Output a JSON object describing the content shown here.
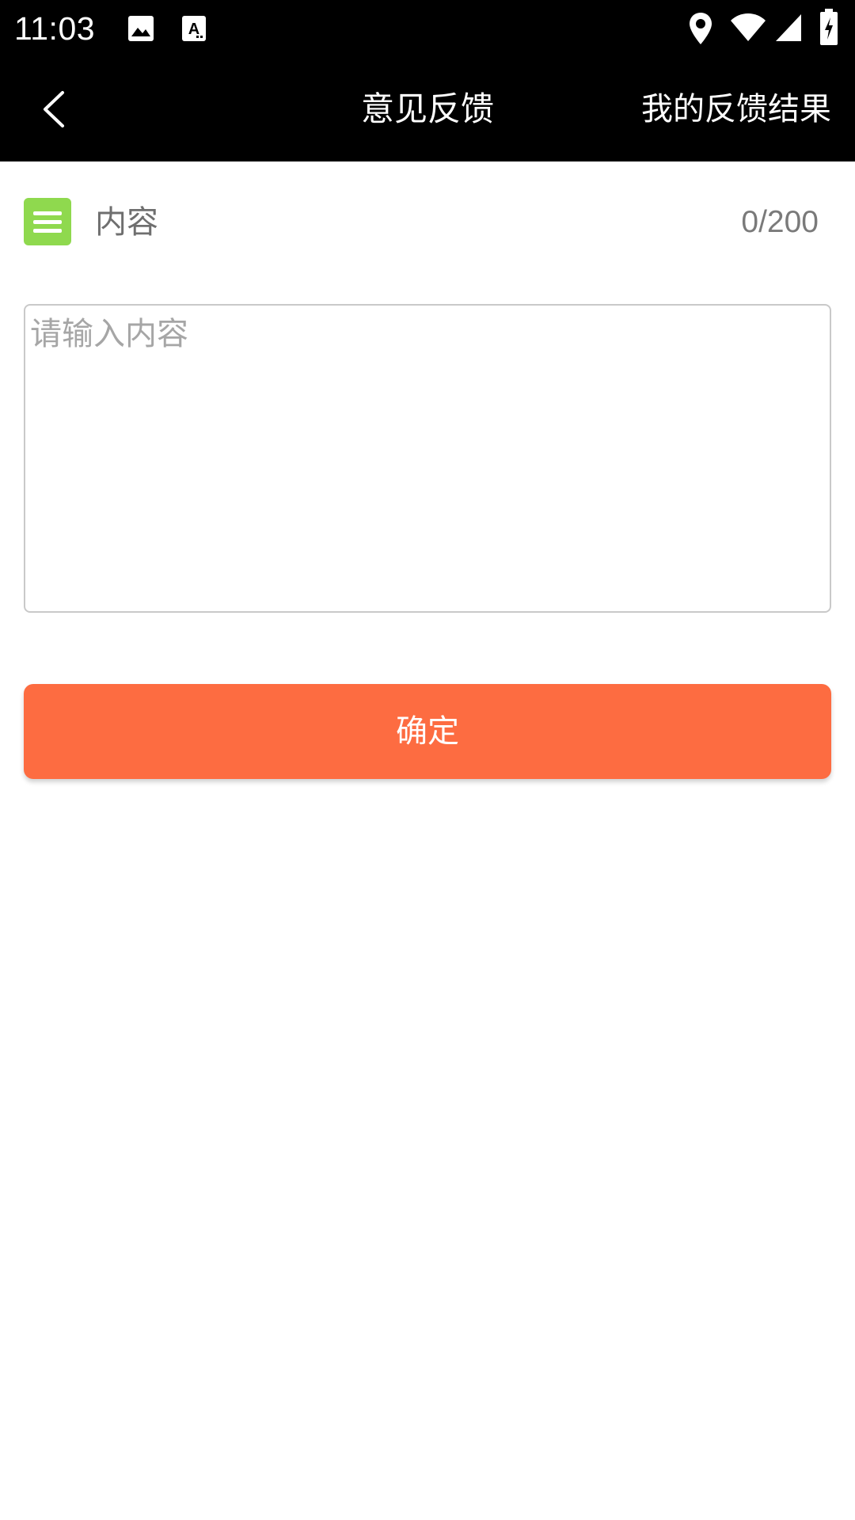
{
  "status_bar": {
    "time": "11:03",
    "left_icons": [
      "image-icon",
      "text-a-icon"
    ],
    "right_icons": [
      "location-icon",
      "wifi-icon",
      "signal-icon",
      "battery-charging-icon"
    ]
  },
  "header": {
    "back_icon": "chevron-left-icon",
    "title": "意见反馈",
    "action_label": "我的反馈结果"
  },
  "content": {
    "icon": "list-icon",
    "icon_color": "#8fd94e",
    "label": "内容",
    "counter": "0/200",
    "textarea_placeholder": "请输入内容",
    "textarea_value": ""
  },
  "submit": {
    "label": "确定",
    "color": "#fd6c41"
  },
  "colors": {
    "header_bg": "#000000",
    "page_bg": "#ffffff"
  }
}
